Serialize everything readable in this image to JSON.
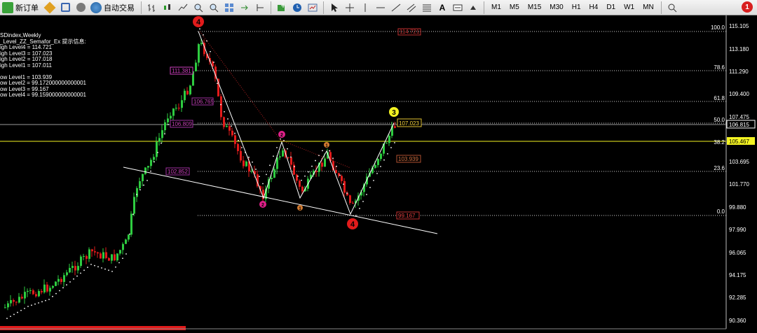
{
  "toolbar": {
    "new_order_label": "新订单",
    "autotrade_label": "自动交易",
    "timeframes": [
      "M1",
      "M5",
      "M15",
      "M30",
      "H1",
      "H4",
      "D1",
      "W1",
      "MN"
    ],
    "notification_count": "1"
  },
  "chart": {
    "symbol_title": "SDindex,Weekly",
    "indicator_header": "_Level_ZZ_Semafor_Ex 提示信息:",
    "high_lines": [
      "igh Level4 = 114.721",
      "igh Level3 = 107.023",
      "igh Level2 = 107.018",
      "igh Level1 = 107.011"
    ],
    "low_lines": [
      "ow Level1 = 103.939",
      "ow Level2 = 99.172000000000001",
      "ow Level3 = 99.167",
      "ow Level4 = 99.159000000000001"
    ],
    "price_axis": [
      "115.105",
      "113.180",
      "111.290",
      "109.400",
      "107.475",
      "106.815",
      "105.467",
      "103.695",
      "101.770",
      "99.880",
      "97.990",
      "96.065",
      "94.175",
      "92.285",
      "90.360"
    ],
    "current_price": "106.815",
    "marked_price": "105.467",
    "fib_levels": [
      "100.0",
      "78.6",
      "61.8",
      "50.0",
      "38.2",
      "23.6",
      "0.0"
    ],
    "price_tags": [
      "114.721",
      "111.381",
      "106.765",
      "106.809",
      "102.852",
      "107.023",
      "103.939",
      "99.167"
    ],
    "semafor_labels": [
      "4",
      "3",
      "2",
      "2",
      "1",
      "1",
      "4"
    ]
  },
  "colors": {
    "bull": "#2ecc40",
    "bear": "#e21b1b",
    "magenta": "#e0208a",
    "orange": "#d27a30",
    "yellow": "#f3f322"
  }
}
